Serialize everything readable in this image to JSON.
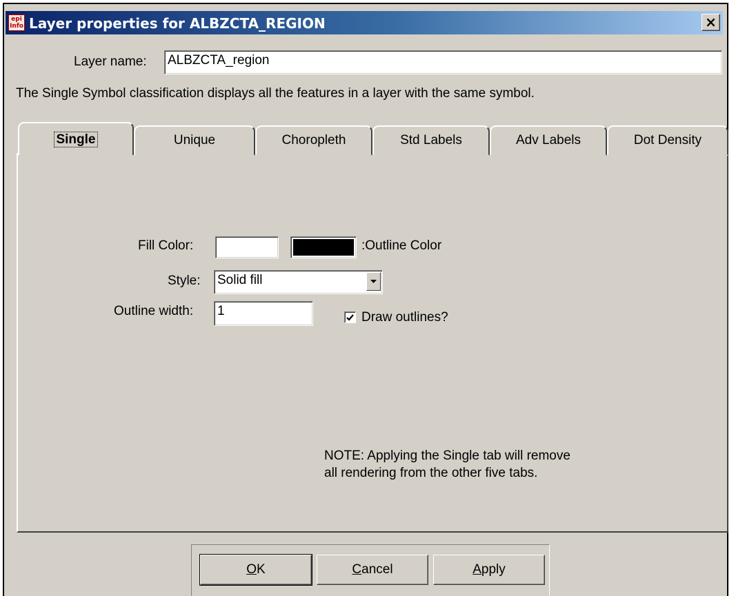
{
  "window": {
    "title": "Layer properties for ALBZCTA_REGION",
    "app_icon": "epi-info-icon",
    "app_icon_text": "epi Info",
    "close_glyph": "×"
  },
  "layer_name": {
    "label": "Layer name:",
    "value": "ALBZCTA_region"
  },
  "description": "The Single Symbol classification displays all the features in a layer with the same symbol.",
  "tabs": [
    {
      "label": "Single",
      "active": true
    },
    {
      "label": "Unique"
    },
    {
      "label": "Choropleth"
    },
    {
      "label": "Std Labels"
    },
    {
      "label": "Adv Labels"
    },
    {
      "label": "Dot Density"
    }
  ],
  "single": {
    "fill_color_label": "Fill Color:",
    "fill_color": "#ffffff",
    "outline_color_label": ":Outline Color",
    "outline_color": "#000000",
    "style_label": "Style:",
    "style_value": "Solid fill",
    "outline_width_label": "Outline width:",
    "outline_width_value": "1",
    "draw_outlines_label": "Draw outlines?",
    "draw_outlines_checked": true,
    "note_line1": "NOTE: Applying the Single tab will remove",
    "note_line2": "all rendering from the other five tabs."
  },
  "buttons": {
    "ok": {
      "mnemonic": "O",
      "rest": "K"
    },
    "cancel": {
      "mnemonic": "C",
      "rest": "ancel"
    },
    "apply": {
      "mnemonic": "A",
      "rest": "pply"
    }
  },
  "colors": {
    "titlebar_start": "#0a246a",
    "titlebar_end": "#a6caf0",
    "face": "#d4d0c8"
  }
}
